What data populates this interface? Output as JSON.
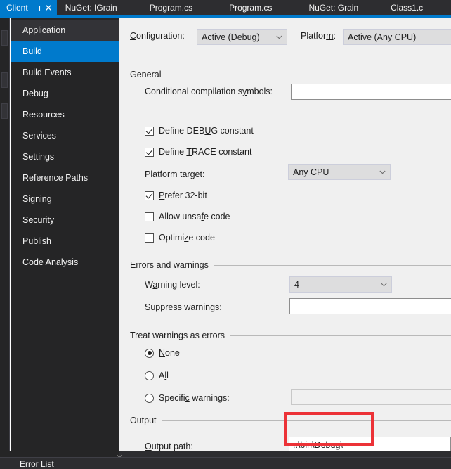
{
  "window": {
    "accent_color": "#007acc",
    "chrome_bg": "#2d2d30",
    "sidebar_bg": "#252526",
    "pane_bg": "#f0f0f0",
    "highlight_color": "#ec3237"
  },
  "tabs": {
    "items": [
      {
        "label": "Client",
        "active": true,
        "pin_icon": "pin-icon",
        "close_icon": "close-icon"
      },
      {
        "label": "NuGet: IGrain",
        "active": false
      },
      {
        "label": "Program.cs",
        "active": false
      },
      {
        "label": "Program.cs",
        "active": false
      },
      {
        "label": "NuGet: Grain",
        "active": false
      },
      {
        "label": "Class1.c",
        "active": false
      }
    ]
  },
  "sidebar": {
    "items": [
      {
        "label": "Application",
        "state": "hover"
      },
      {
        "label": "Build",
        "state": "selected"
      },
      {
        "label": "Build Events",
        "state": "normal"
      },
      {
        "label": "Debug",
        "state": "normal"
      },
      {
        "label": "Resources",
        "state": "normal"
      },
      {
        "label": "Services",
        "state": "normal"
      },
      {
        "label": "Settings",
        "state": "normal"
      },
      {
        "label": "Reference Paths",
        "state": "normal"
      },
      {
        "label": "Signing",
        "state": "normal"
      },
      {
        "label": "Security",
        "state": "normal"
      },
      {
        "label": "Publish",
        "state": "normal"
      },
      {
        "label": "Code Analysis",
        "state": "normal"
      }
    ]
  },
  "toolbar": {
    "configuration_label": "Configuration:",
    "configuration_value": "Active (Debug)",
    "platform_label": "Platform:",
    "platform_value": "Active (Any CPU)"
  },
  "general": {
    "group_title": "General",
    "conditional_symbols_label": "Conditional compilation symbols:",
    "conditional_symbols_value": "",
    "define_debug_label": "Define DEBUG constant",
    "define_debug_checked": true,
    "define_trace_label": "Define TRACE constant",
    "define_trace_checked": true,
    "platform_target_label": "Platform target:",
    "platform_target_value": "Any CPU",
    "prefer_32bit_label": "Prefer 32-bit",
    "prefer_32bit_checked": true,
    "allow_unsafe_label": "Allow unsafe code",
    "allow_unsafe_checked": false,
    "optimize_code_label": "Optimize code",
    "optimize_code_checked": false
  },
  "errors_warnings": {
    "group_title": "Errors and warnings",
    "warning_level_label": "Warning level:",
    "warning_level_value": "4",
    "suppress_warnings_label": "Suppress warnings:",
    "suppress_warnings_value": ""
  },
  "treat_warnings": {
    "group_title": "Treat warnings as errors",
    "none_label": "None",
    "none_selected": true,
    "all_label": "All",
    "all_selected": false,
    "specific_label": "Specific warnings:",
    "specific_selected": false,
    "specific_value": ""
  },
  "output": {
    "group_title": "Output",
    "output_path_label": "Output path:",
    "output_path_value": "..\\bin\\Debug\\"
  },
  "bottom": {
    "error_list_label": "Error List"
  }
}
